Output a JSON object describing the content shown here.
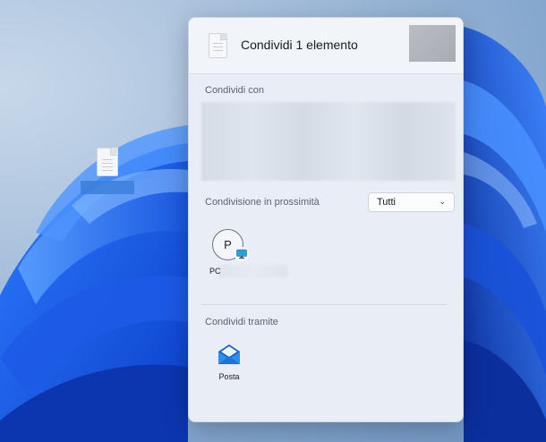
{
  "panel": {
    "title": "Condividi 1 elemento",
    "share_with_label": "Condividi con",
    "nearby_label": "Condivisione in prossimità",
    "nearby_filter": {
      "selected": "Tutti"
    },
    "devices": [
      {
        "avatar_letter": "P",
        "name_prefix": "PC"
      }
    ],
    "share_via_label": "Condividi tramite",
    "apps": [
      {
        "name": "Posta",
        "icon": "mail-icon"
      }
    ]
  },
  "icons": {
    "header_file": "document-icon",
    "desktop_file": "document-icon",
    "device_badge": "monitor-icon",
    "dropdown": "chevron-down-icon"
  },
  "colors": {
    "panel_bg": "#e9eef6",
    "accent_blue": "#1f6fd6",
    "selection_blue": "#3c7fd9"
  }
}
